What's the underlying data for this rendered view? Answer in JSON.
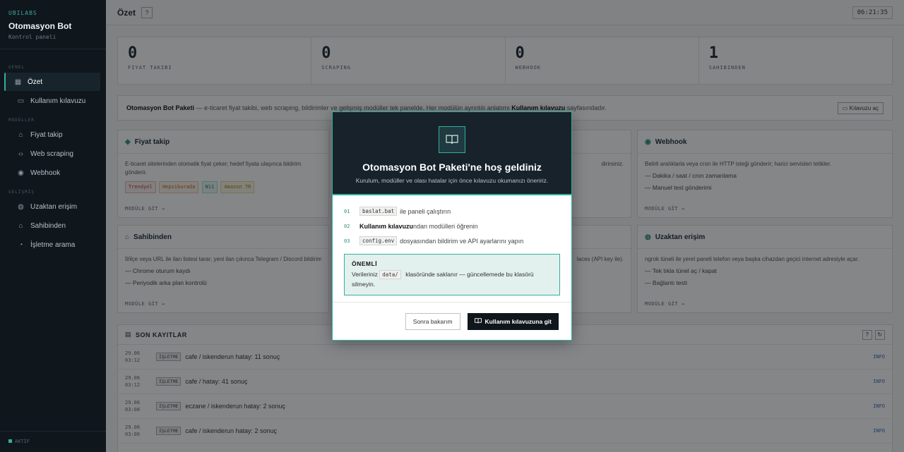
{
  "sidebar": {
    "brand_tag": "UBILABS",
    "title": "Otomasyon Bot",
    "subtitle": "Kontrol paneli",
    "sections": [
      {
        "label": "GENEL",
        "items": [
          {
            "label": "Özet",
            "icon": "grid-icon",
            "active": true
          },
          {
            "label": "Kullanım kılavuzu",
            "icon": "book-icon",
            "active": false
          }
        ]
      },
      {
        "label": "MODÜLLER",
        "items": [
          {
            "label": "Fiyat takip",
            "icon": "tag-icon",
            "active": false
          },
          {
            "label": "Web scraping",
            "icon": "code-icon",
            "active": false
          },
          {
            "label": "Webhook",
            "icon": "signal-icon",
            "active": false
          }
        ]
      },
      {
        "label": "GELİŞMİŞ",
        "items": [
          {
            "label": "Uzaktan erişim",
            "icon": "globe-icon",
            "active": false
          },
          {
            "label": "Sahibinden",
            "icon": "home-icon",
            "active": false
          },
          {
            "label": "İşletme arama",
            "icon": "pin-icon",
            "active": false
          }
        ]
      }
    ],
    "footer": "AKTİF"
  },
  "topbar": {
    "title": "Özet",
    "help": "?",
    "clock": "06:21:35"
  },
  "stats": [
    {
      "value": "0",
      "label": "FIYAT TAKIBI"
    },
    {
      "value": "0",
      "label": "SCRAPING"
    },
    {
      "value": "0",
      "label": "WEBHOOK"
    },
    {
      "value": "1",
      "label": "SAHIBINDEN"
    }
  ],
  "intro": {
    "bold_start": "Otomasyon Bot Paketi",
    "text": " — e-ticaret fiyat takibi, web scraping, bildirimler ve gelişmiş modüller tek panelde. Her modülün ayrıntılı anlatımı ",
    "bold_link": "Kullanım kılavuzu",
    "text_end": " sayfasındadır.",
    "button": "Kılavuzu aç"
  },
  "cards": {
    "fiyat": {
      "title": "Fiyat takip",
      "desc": "E-ticaret sitelerinden otomatik fiyat çeker; hedef fiyata ulaşınca bildirim gönderir.",
      "chips": [
        "Trendyol",
        "Hepsiburada",
        "N11",
        "Amazon TR"
      ],
      "foot": "MODÜLE GİT →"
    },
    "webhook": {
      "title": "Webhook",
      "desc": "Belirli aralıklarla veya cron ile HTTP isteği gönderir; harici servisleri tetikler.",
      "list": [
        "Dakika / saat / cron zamanlama",
        "Manuel test gönderimi"
      ],
      "foot": "MODÜLE GİT →"
    },
    "sahibinden": {
      "title": "Sahibinden",
      "desc": "İl/ilçe veya URL ile ilan listesi tarar; yeni ilan çıkınca Telegram / Discord bildirimi",
      "list": [
        "Chrome oturum kaydı",
        "Periyodik arka plan kontrolü"
      ],
      "foot": "MODÜLE GİT →"
    },
    "uzaktan": {
      "title": "Uzaktan erişim",
      "desc": "ngrok tüneli ile yerel paneli telefon veya başka cihazdan geçici internet adresiyle açar.",
      "list": [
        "Tek tıkla tünel aç / kapat",
        "Bağlantı testi"
      ],
      "foot": "MODÜLE GİT →"
    },
    "mid_top_text": "dirirsiniz.",
    "mid_bottom_text": "laces (API key ile)."
  },
  "logs": {
    "title": "SON KAYITLAR",
    "rows": [
      {
        "date": "29.06",
        "time": "03:12",
        "tag": "İŞLETME",
        "msg": "cafe / iskenderun hatay: 11 sonuç",
        "level": "INFO"
      },
      {
        "date": "29.06",
        "time": "03:12",
        "tag": "İŞLETME",
        "msg": "cafe / hatay: 41 sonuç",
        "level": "INFO"
      },
      {
        "date": "29.06",
        "time": "03:08",
        "tag": "İŞLETME",
        "msg": "eczane / iskenderun hatay: 2 sonuç",
        "level": "INFO"
      },
      {
        "date": "29.06",
        "time": "03:06",
        "tag": "İŞLETME",
        "msg": "cafe / iskenderun hatay: 2 sonuç",
        "level": "INFO"
      }
    ]
  },
  "modal": {
    "title": "Otomasyon Bot Paketi'ne hoş geldiniz",
    "subtitle": "Kurulum, modüller ve olası hatalar için önce kılavuzu okumanızı öneririz.",
    "steps": [
      {
        "num": "01",
        "code": "baslat.bat",
        "text": "ile paneli çalıştırın"
      },
      {
        "num": "02",
        "bold": "Kullanım kılavuzu",
        "text": "ndan modülleri öğrenin"
      },
      {
        "num": "03",
        "code": "config.env",
        "text": "dosyasından bildirim ve API ayarlarını yapın"
      }
    ],
    "notice_title": "ÖNEMLİ",
    "notice_pre": "Verileriniz",
    "notice_code": "data/",
    "notice_post": "klasöründe saklanır — güncellemede bu klasörü silmeyin.",
    "btn_later": "Sonra bakarım",
    "btn_go": "Kullanım kılavuzuna git"
  },
  "colors": {
    "accent": "#2fb19f",
    "sidebar": "#0f161c",
    "hero": "#17222b"
  }
}
